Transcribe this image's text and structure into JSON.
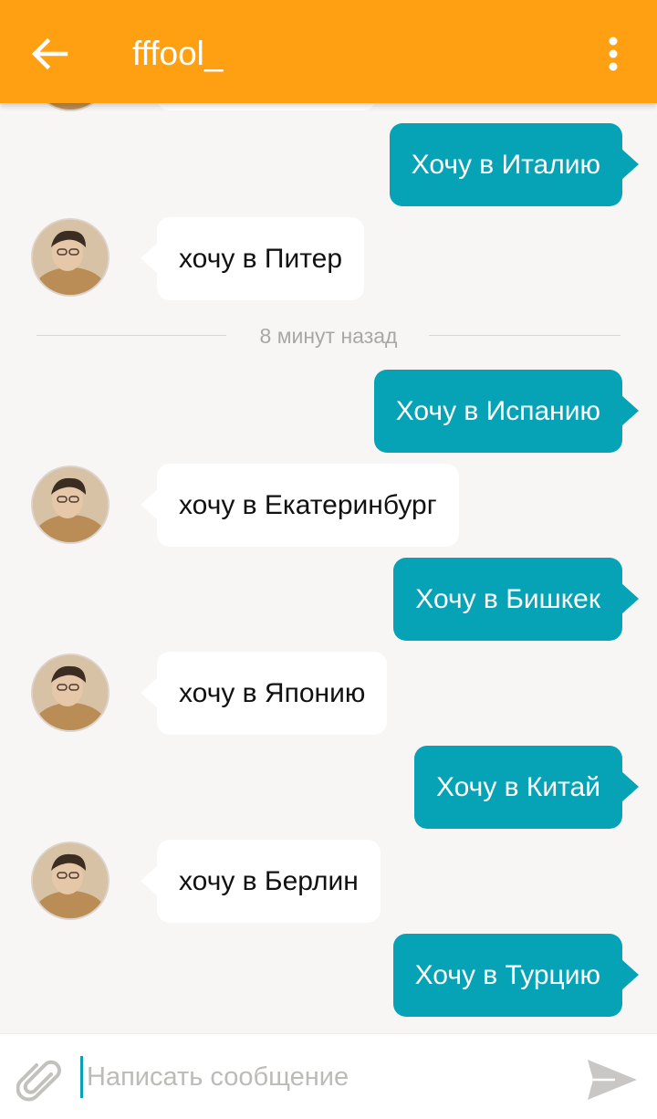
{
  "header": {
    "title": "fffool_",
    "back_icon": "arrow-left-icon",
    "menu_icon": "more-vertical-icon",
    "bg_color": "#ff9f12"
  },
  "chat": {
    "timestamp_divider": "8 минут назад",
    "messages": [
      {
        "from": "me",
        "text": "Хочу в Италию"
      },
      {
        "from": "them",
        "text": "хочу в Питер"
      },
      {
        "from": "me",
        "text": "Хочу в Испанию"
      },
      {
        "from": "them",
        "text": "хочу в Екатеринбург"
      },
      {
        "from": "me",
        "text": "Хочу в Бишкек"
      },
      {
        "from": "them",
        "text": "хочу в Японию"
      },
      {
        "from": "me",
        "text": "Хочу в Китай"
      },
      {
        "from": "them",
        "text": "хочу в Берлин"
      },
      {
        "from": "me",
        "text": "Хочу в Турцию"
      }
    ],
    "outgoing_color": "#05a3b5",
    "incoming_color": "#ffffff"
  },
  "composer": {
    "placeholder": "Написать сообщение",
    "value": "",
    "attach_icon": "paperclip-icon",
    "send_icon": "send-icon"
  }
}
